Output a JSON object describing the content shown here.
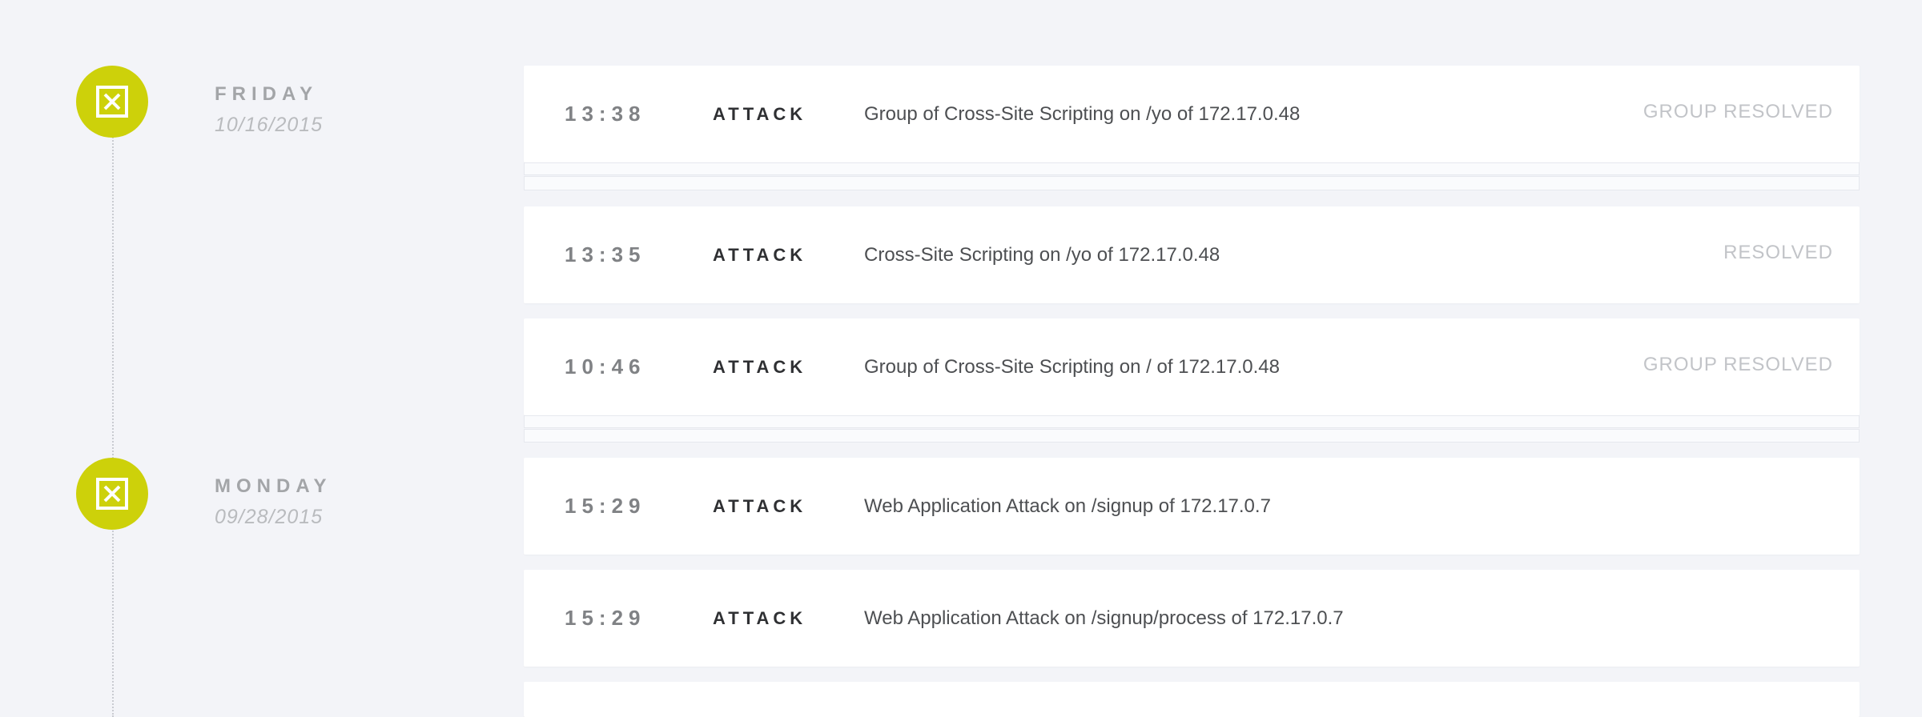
{
  "colors": {
    "background": "#f3f4f8",
    "accent": "#cdd10a",
    "card": "#ffffff",
    "status_text": "#c2c4c8"
  },
  "days": [
    {
      "name": "FRIDAY",
      "date": "10/16/2015",
      "icon": "close-box-icon",
      "events": [
        {
          "time": "13:38",
          "type": "ATTACK",
          "description": "Group of Cross-Site Scripting on /yo of 172.17.0.48",
          "status": "GROUP RESOLVED"
        },
        {
          "time": "13:35",
          "type": "ATTACK",
          "description": "Cross-Site Scripting on /yo of 172.17.0.48",
          "status": "RESOLVED"
        },
        {
          "time": "10:46",
          "type": "ATTACK",
          "description": "Group of Cross-Site Scripting on / of 172.17.0.48",
          "status": "GROUP RESOLVED"
        }
      ]
    },
    {
      "name": "MONDAY",
      "date": "09/28/2015",
      "icon": "close-box-icon",
      "events": [
        {
          "time": "15:29",
          "type": "ATTACK",
          "description": "Web Application Attack on /signup of 172.17.0.7",
          "status": ""
        },
        {
          "time": "15:29",
          "type": "ATTACK",
          "description": "Web Application Attack on /signup/process of 172.17.0.7",
          "status": ""
        }
      ]
    }
  ]
}
